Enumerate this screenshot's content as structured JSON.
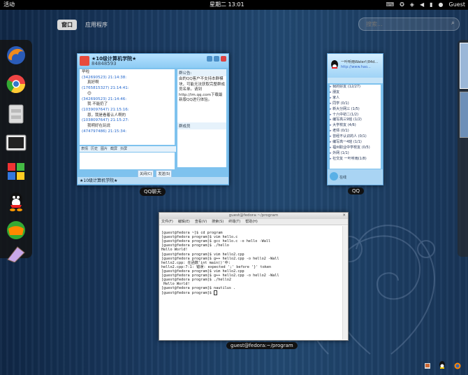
{
  "topbar": {
    "activities": "活动",
    "clock": "星期二 13:01",
    "user": "Guest",
    "icons": [
      "keyboard-icon",
      "accessibility-icon",
      "network-icon",
      "volume-icon",
      "battery-icon"
    ]
  },
  "view_switcher": {
    "tabs": [
      "窗口",
      "应用程序"
    ],
    "active": 0
  },
  "search": {
    "placeholder": "搜索..."
  },
  "dash": {
    "apps": [
      "firefox-icon",
      "chrome-icon",
      "files-icon",
      "terminal-icon",
      "windows-icon",
      "qq-icon",
      "mail-icon",
      "wine-icon"
    ]
  },
  "windows": {
    "qq_chat": {
      "caption": "QQ聊天",
      "title": "★10级计算机学院★",
      "number": "84848593",
      "messages": [
        {
          "text": "早啦"
        },
        {
          "time": "(342690523) 21:14:38:",
          "text": "真好啊"
        },
        {
          "time": "(1765815327) 21:14:41:",
          "text": "😊"
        },
        {
          "time": "(342690523) 21:14:46:",
          "text": "我 不能扔了"
        },
        {
          "time": "(1039097647) 21:15:16:",
          "text": "恩，我是看着认人啊的"
        },
        {
          "time": "(1038097647) 21:15:27:",
          "text": "我明好在玩说"
        },
        {
          "time": "(474797486) 21:15:34:",
          "text": ""
        }
      ],
      "toolbar": [
        "表情",
        "历史",
        "图片",
        "截屏",
        "抖屏"
      ],
      "input_text": "",
      "close_button": "关闭(C)",
      "send_button": "发送(S)",
      "notice_title": "群公告:",
      "notice_text": "由的QQ客户不支持本群模块，可能无法获取完整群成员名单。请到http://im.qq.com下载最新版QQ进行体验。",
      "members_title": "群成员",
      "footer": "★10级计算机学院★"
    },
    "qq_list": {
      "caption": "QQ",
      "nickname": "一叶听雨Water!(84d...",
      "signature": "http://www.hao...",
      "groups": [
        "我的好友 (12/27)",
        "朋友",
        "家人",
        "同学 (0/1)",
        "新大分网三 (1/5)",
        "十六中初二(1/2)",
        "编写高三9班 (1/2)",
        "大学校友 (4/6)",
        "老师 (0/1)",
        "曾经不认识的人 (0/1)",
        "编写高一4班 (1/1)",
        "福州职业中学校友 (0/5)",
        "外网 (1/1)",
        "社交友 一叶听雨(1/8)"
      ],
      "status": "在线"
    },
    "terminal": {
      "caption": "guest@fedora:~/program",
      "title": "guest@fedora:~/program",
      "menus": [
        "文件(F)",
        "编辑(E)",
        "查看(V)",
        "搜索(S)",
        "终端(T)",
        "帮助(H)"
      ],
      "lines": [
        "[guest@fedora ~]$ cd program",
        "[guest@fedora program]$ vim hello.c",
        "[guest@fedora program]$ gcc hello.c -o hello -Wall",
        "[guest@fedora program]$ ./hello",
        "Hello World!",
        "[guest@fedora program]$ vim hello2.cpp",
        "[guest@fedora program]$ g++ hello2.cpp -o hello2 -Wall",
        "hello2.cpp: 在函数'int main()'中:",
        "hello2.cpp:7:1: 错误: expected ';' before '}' token",
        "[guest@fedora program]$ vim hello2.cpp",
        "[guest@fedora program]$ g++ hello2.cpp -o hello2 -Wall",
        "[guest@fedora program]$ ./hello2",
        " Hello World!",
        "[guest@fedora program]$ nautilus .",
        "[guest@fedora program]$ "
      ]
    }
  }
}
